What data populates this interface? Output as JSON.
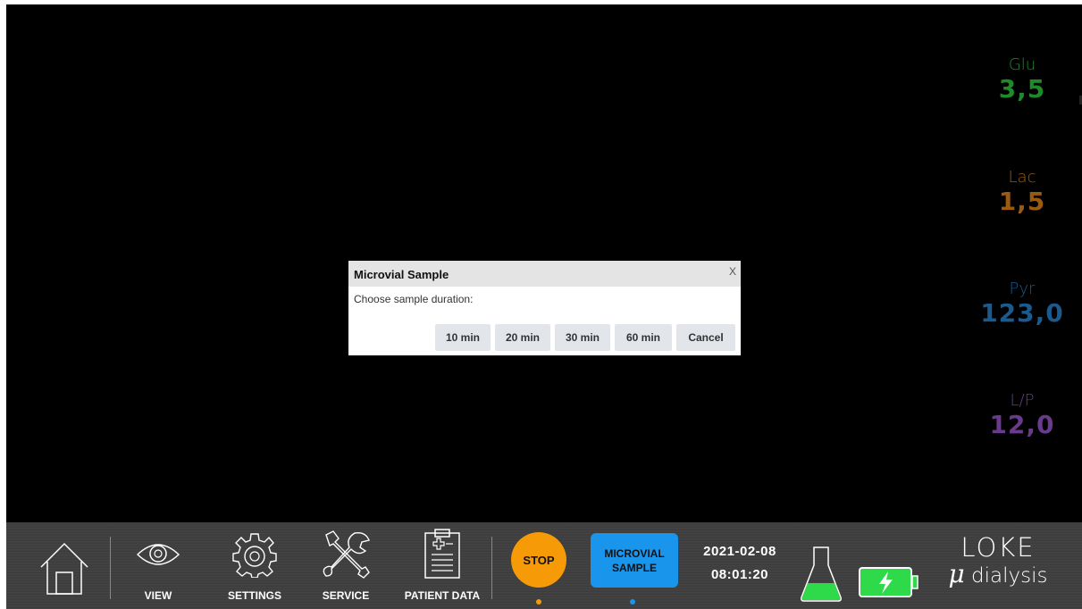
{
  "readings": {
    "glu": {
      "label": "Glu",
      "value": "3,5",
      "color": "#1f8a2a"
    },
    "lac": {
      "label": "Lac",
      "value": "1,5",
      "color": "#9a5a12"
    },
    "pyr": {
      "label": "Pyr",
      "value": "123,0",
      "color": "#1a5a8e"
    },
    "lp": {
      "label": "L/P",
      "value": "12,0",
      "color": "#6a3a8c"
    }
  },
  "dialog": {
    "title": "Microvial Sample",
    "close": "X",
    "prompt": "Choose sample duration:",
    "buttons": [
      "10 min",
      "20 min",
      "30 min",
      "60 min",
      "Cancel"
    ]
  },
  "nav": {
    "home_icon": "home-icon",
    "view": "VIEW",
    "settings": "SETTINGS",
    "service": "SERVICE",
    "patient_data": "PATIENT DATA"
  },
  "actions": {
    "stop": "STOP",
    "stop_color": "#f79a07",
    "microvial_line1": "MICROVIAL",
    "microvial_line2": "SAMPLE",
    "microvial_color": "#1995ec"
  },
  "status": {
    "date": "2021-02-08",
    "time": "08:01:20",
    "flask_icon": "flask-icon",
    "battery_icon": "battery-charging-icon",
    "battery_color": "#2ed94a"
  },
  "logo": {
    "line1": "LOKE",
    "mu": "μ",
    "line2": "dialysis"
  }
}
